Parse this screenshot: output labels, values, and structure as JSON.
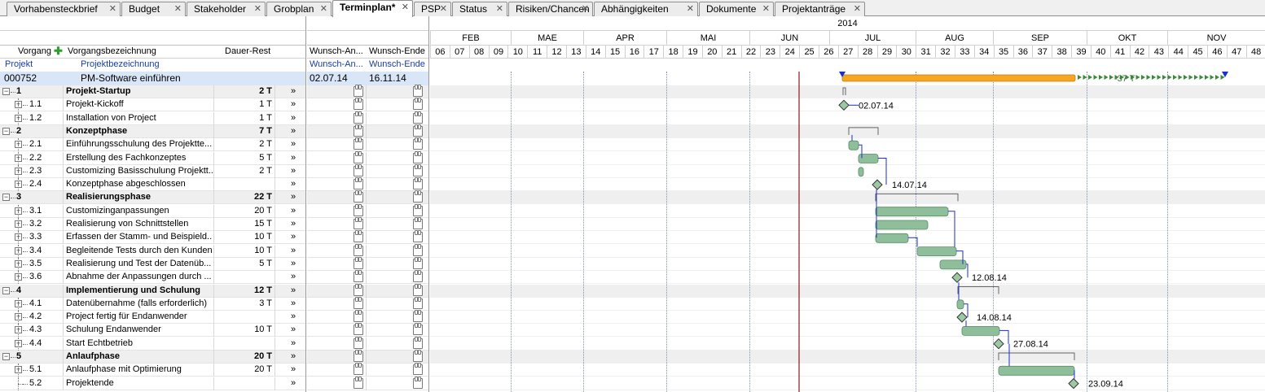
{
  "tabs": [
    {
      "label": "Vorhabensteckbrief",
      "active": false
    },
    {
      "label": "Budget",
      "active": false
    },
    {
      "label": "Stakeholder",
      "active": false
    },
    {
      "label": "Grobplan",
      "active": false
    },
    {
      "label": "Terminplan*",
      "active": true
    },
    {
      "label": "PSP",
      "active": false
    },
    {
      "label": "Status",
      "active": false
    },
    {
      "label": "Risiken/Chancen",
      "active": false
    },
    {
      "label": "Abhängigkeiten",
      "active": false
    },
    {
      "label": "Dokumente",
      "active": false
    },
    {
      "label": "Projektanträge",
      "active": false
    }
  ],
  "close_glyph": "✕",
  "columns": {
    "vorgang": "Vorgang",
    "name": "Vorgangsbezeichnung",
    "dauer": "Dauer-Rest",
    "wunsch_an": "Wunsch-An...",
    "wunsch_ende": "Wunsch-Ende"
  },
  "subheader": {
    "projekt": "Projekt",
    "bezeichnung": "Projektbezeichnung",
    "wunsch_an": "Wunsch-An...",
    "wunsch_ende": "Wunsch-Ende"
  },
  "add_icon": "plus-icon",
  "project": {
    "id": "000752",
    "name": "PM-Software einführen",
    "start": "02.07.14",
    "end": "16.11.14",
    "delay_label": "-37 T"
  },
  "year": "2014",
  "months": [
    "FEB",
    "MAE",
    "APR",
    "MAI",
    "JUN",
    "JUL",
    "AUG",
    "SEP",
    "OKT",
    "NOV"
  ],
  "weeks": [
    "06",
    "07",
    "08",
    "09",
    "10",
    "11",
    "12",
    "13",
    "14",
    "15",
    "16",
    "17",
    "18",
    "19",
    "20",
    "21",
    "22",
    "23",
    "24",
    "25",
    "26",
    "27",
    "28",
    "29",
    "30",
    "31",
    "32",
    "33",
    "34",
    "35",
    "36",
    "37",
    "38",
    "39",
    "40",
    "41",
    "42",
    "43",
    "44",
    "45",
    "46",
    "47",
    "48"
  ],
  "arrow": "»",
  "tasks": [
    {
      "id": "1",
      "name": "Projekt-Startup",
      "dauer": "2 T",
      "summary": true
    },
    {
      "id": "1.1",
      "name": "Projekt-Kickoff",
      "dauer": "1 T",
      "summary": false
    },
    {
      "id": "1.2",
      "name": "Installation von Project",
      "dauer": "1 T",
      "summary": false
    },
    {
      "id": "2",
      "name": "Konzeptphase",
      "dauer": "7 T",
      "summary": true
    },
    {
      "id": "2.1",
      "name": "Einführungsschulung des Projektte...",
      "dauer": "2 T",
      "summary": false
    },
    {
      "id": "2.2",
      "name": "Erstellung des Fachkonzeptes",
      "dauer": "5 T",
      "summary": false
    },
    {
      "id": "2.3",
      "name": "Customizing Basisschulung Projektt...",
      "dauer": "2 T",
      "summary": false
    },
    {
      "id": "2.4",
      "name": "Konzeptphase abgeschlossen",
      "dauer": "",
      "summary": false
    },
    {
      "id": "3",
      "name": "Realisierungsphase",
      "dauer": "22 T",
      "summary": true
    },
    {
      "id": "3.1",
      "name": "Customizinganpassungen",
      "dauer": "20 T",
      "summary": false
    },
    {
      "id": "3.2",
      "name": "Realisierung von Schnittstellen",
      "dauer": "15 T",
      "summary": false
    },
    {
      "id": "3.3",
      "name": "Erfassen der Stamm- und Beispield...",
      "dauer": "10 T",
      "summary": false
    },
    {
      "id": "3.4",
      "name": "Begleitende Tests durch den Kunden",
      "dauer": "10 T",
      "summary": false
    },
    {
      "id": "3.5",
      "name": "Realisierung und Test der Datenüb...",
      "dauer": "5 T",
      "summary": false
    },
    {
      "id": "3.6",
      "name": "Abnahme der Anpassungen durch ...",
      "dauer": "",
      "summary": false
    },
    {
      "id": "4",
      "name": "Implementierung und Schulung",
      "dauer": "12 T",
      "summary": true
    },
    {
      "id": "4.1",
      "name": "Datenübernahme (falls erforderlich)",
      "dauer": "3 T",
      "summary": false
    },
    {
      "id": "4.2",
      "name": "Project fertig für Endanwender",
      "dauer": "",
      "summary": false
    },
    {
      "id": "4.3",
      "name": "Schulung Endanwender",
      "dauer": "10 T",
      "summary": false
    },
    {
      "id": "4.4",
      "name": "Start Echtbetrieb",
      "dauer": "",
      "summary": false
    },
    {
      "id": "5",
      "name": "Anlaufphase",
      "dauer": "20 T",
      "summary": true
    },
    {
      "id": "5.1",
      "name": "Anlaufphase mit Optimierung",
      "dauer": "20 T",
      "summary": false
    },
    {
      "id": "5.2",
      "name": "Projektende",
      "dauer": "",
      "summary": false
    }
  ],
  "milestone_labels": [
    "02.07.14",
    "14.07.14",
    "12.08.14",
    "14.08.14",
    "27.08.14",
    "23.09.14"
  ],
  "colors": {
    "project_bar": "#f5a623",
    "task_bar": "#8fbf9a",
    "today_line": "#8b1a1a",
    "header_blue": "#1a3da8",
    "selected_row": "#d8e6f8"
  }
}
